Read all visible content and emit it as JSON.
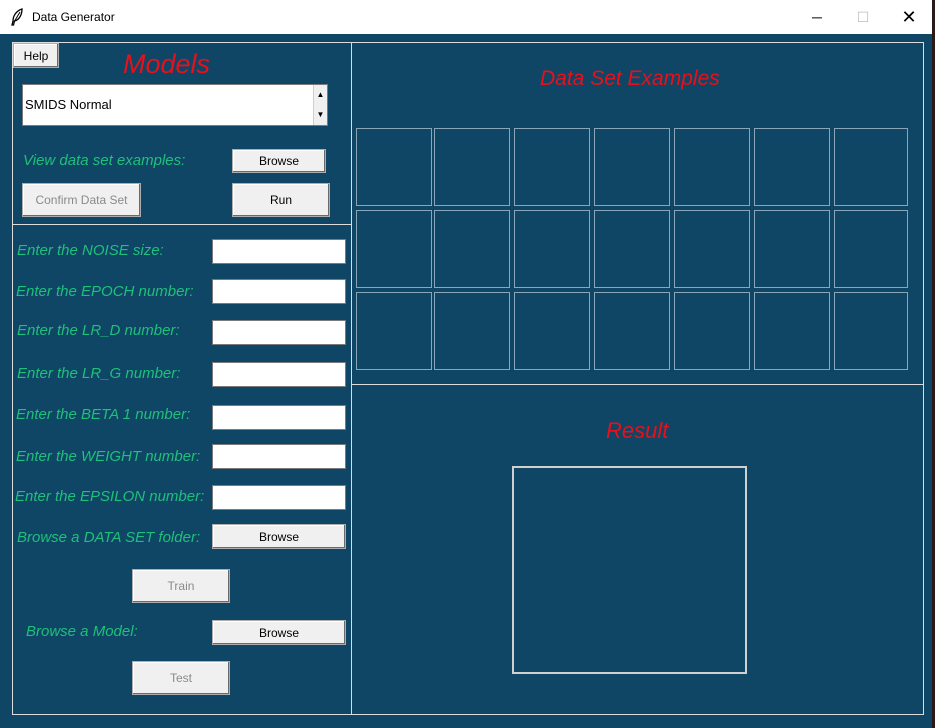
{
  "window": {
    "title": "Data Generator",
    "minimize_glyph": "─",
    "maximize_glyph": "☐",
    "close_glyph": "✕"
  },
  "left_top": {
    "help_label": "Help",
    "models_heading": "Models",
    "model_selected": "SMIDS Normal",
    "scroll_up": "▲",
    "scroll_down": "▼",
    "view_examples_label": "View data set examples:",
    "browse_examples_label": "Browse",
    "confirm_label": "Confirm Data Set",
    "run_label": "Run"
  },
  "params": [
    {
      "label": "Enter the NOISE size:",
      "value": ""
    },
    {
      "label": "Enter the EPOCH number:",
      "value": ""
    },
    {
      "label": "Enter the LR_D number:",
      "value": ""
    },
    {
      "label": "Enter the LR_G number:",
      "value": ""
    },
    {
      "label": "Enter the BETA 1 number:",
      "value": ""
    },
    {
      "label": "Enter the WEIGHT number:",
      "value": ""
    },
    {
      "label": "Enter the EPSILON number:",
      "value": ""
    }
  ],
  "dataset_folder": {
    "label": "Browse a DATA SET folder:",
    "button": "Browse"
  },
  "train_label": "Train",
  "model_browse": {
    "label": "Browse a Model:",
    "button": "Browse"
  },
  "test_label": "Test",
  "examples": {
    "heading": "Data Set Examples"
  },
  "result": {
    "heading": "Result"
  },
  "colors": {
    "window_bg": "#0f4565",
    "label_green": "#1ec07a",
    "heading_red": "#e8101a",
    "border_light": "#dcdcdc"
  },
  "icons": {
    "app": "feather-icon"
  }
}
